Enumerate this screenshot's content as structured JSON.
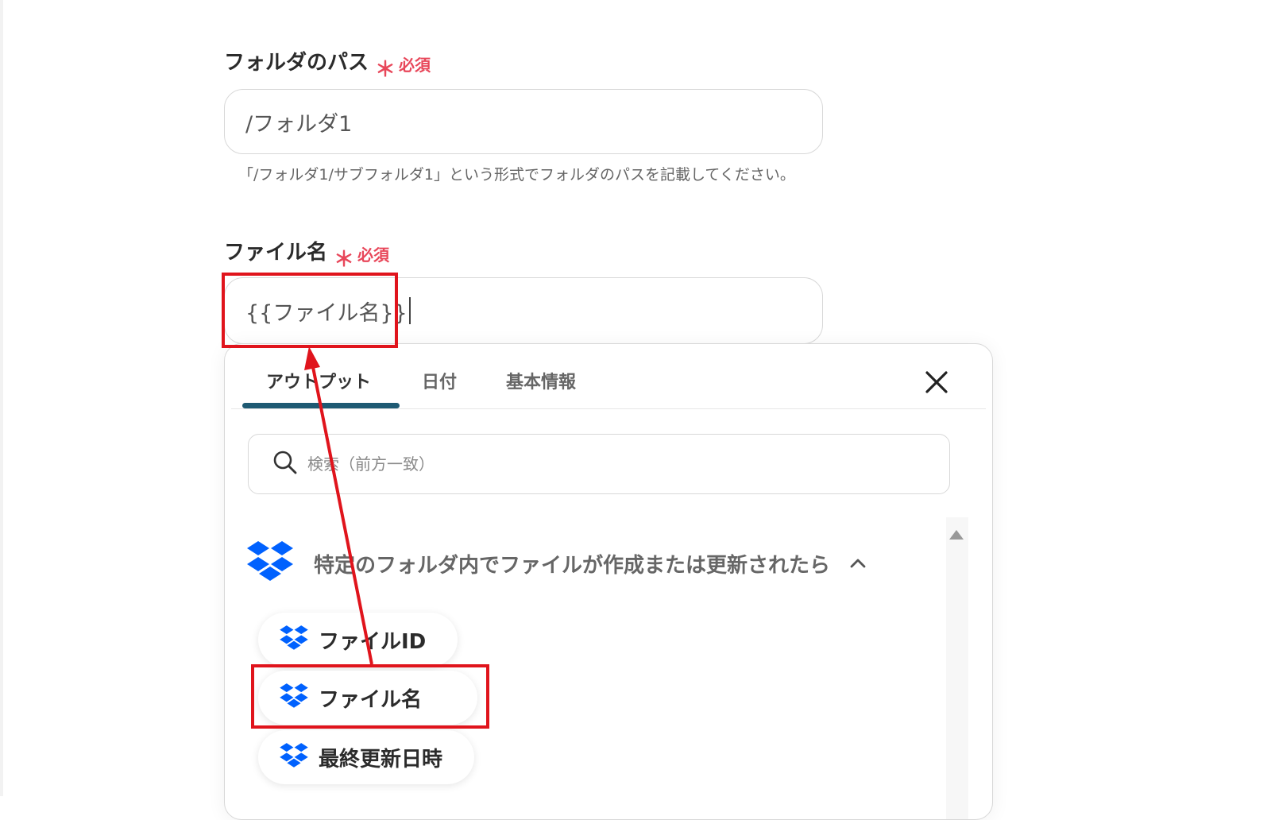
{
  "folder_path": {
    "label": "フォルダのパス",
    "required_mark": "＊",
    "required_text": "必須",
    "value": "/フォルダ1",
    "hint": "「/フォルダ1/サブフォルダ1」という形式でフォルダのパスを記載してください。"
  },
  "file_name": {
    "label": "ファイル名",
    "required_mark": "＊",
    "required_text": "必須",
    "value": "{{ファイル名}}"
  },
  "panel": {
    "tabs": [
      {
        "label": "アウトプット",
        "active": true
      },
      {
        "label": "日付",
        "active": false
      },
      {
        "label": "基本情報",
        "active": false
      }
    ],
    "close_icon": "close-icon",
    "search": {
      "placeholder": "検索（前方一致）",
      "icon": "search-icon"
    },
    "group": {
      "icon": "dropbox-icon",
      "title": "特定のフォルダ内でファイルが作成または更新されたら",
      "expanded": true
    },
    "items": [
      {
        "label": "ファイルID",
        "icon": "dropbox-icon"
      },
      {
        "label": "ファイル名",
        "icon": "dropbox-icon",
        "highlighted": true
      },
      {
        "label": "最終更新日時",
        "icon": "dropbox-icon"
      }
    ]
  },
  "colors": {
    "required": "#e8475a",
    "active_tab": "#1e5a73",
    "dropbox": "#0061fe",
    "annotation": "#e0141c"
  }
}
